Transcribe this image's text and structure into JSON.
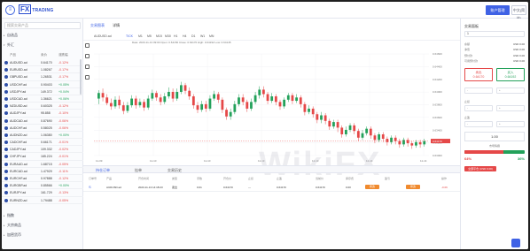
{
  "header": {
    "logo_fx": "FX",
    "logo_trading": "TRADING",
    "btn_primary": "账户管理",
    "btn_secondary": "中文(简体)"
  },
  "left": {
    "search_placeholder": "搜索交易产品",
    "sections": [
      "自选品",
      "外汇",
      "指数",
      "大宗商品",
      "加密货币"
    ],
    "columns": [
      "产品",
      "卖价",
      "涨跌幅"
    ],
    "rows": [
      {
        "symbol": "AUDUSD.ad",
        "price": "0.64170",
        "change": "-0.12%",
        "dir": "neg"
      },
      {
        "symbol": "EURUSD.ad",
        "price": "1.08267",
        "change": "-0.17%",
        "dir": "neg"
      },
      {
        "symbol": "GBPUSD.ad",
        "price": "1.26531",
        "change": "-0.17%",
        "dir": "neg"
      },
      {
        "symbol": "USDCHF.ad",
        "price": "0.90403",
        "change": "+0.05%",
        "dir": "pos"
      },
      {
        "symbol": "USDJPY.ad",
        "price": "149.372",
        "change": "+0.04%",
        "dir": "pos"
      },
      {
        "symbol": "USDCAD.ad",
        "price": "1.36621",
        "change": "+0.06%",
        "dir": "pos"
      },
      {
        "symbol": "NZDUSD.ad",
        "price": "0.60325",
        "change": "-0.12%",
        "dir": "neg"
      },
      {
        "symbol": "AUDJPY.ad",
        "price": "95.858",
        "change": "-0.10%",
        "dir": "neg"
      },
      {
        "symbol": "AUDCAD.ad",
        "price": "0.87690",
        "change": "-0.06%",
        "dir": "neg"
      },
      {
        "symbol": "AUDCHF.ad",
        "price": "0.58025",
        "change": "-0.06%",
        "dir": "neg"
      },
      {
        "symbol": "AUDNZD.ad",
        "price": "1.06380",
        "change": "+0.00%",
        "dir": "pos"
      },
      {
        "symbol": "CADCHF.ad",
        "price": "0.66171",
        "change": "-0.01%",
        "dir": "neg"
      },
      {
        "symbol": "CADJPY.ad",
        "price": "109.332",
        "change": "-0.02%",
        "dir": "neg"
      },
      {
        "symbol": "CHFJPY.ad",
        "price": "165.224",
        "change": "-0.01%",
        "dir": "neg"
      },
      {
        "symbol": "EURAUD.ad",
        "price": "1.68715",
        "change": "-0.05%",
        "dir": "neg"
      },
      {
        "symbol": "EURCAD.ad",
        "price": "1.47929",
        "change": "-0.11%",
        "dir": "neg"
      },
      {
        "symbol": "EURCHF.ad",
        "price": "0.97888",
        "change": "-0.12%",
        "dir": "neg"
      },
      {
        "symbol": "EURGBP.ad",
        "price": "0.85566",
        "change": "+0.00%",
        "dir": "pos"
      },
      {
        "symbol": "EURJPY.ad",
        "price": "161.729",
        "change": "-0.13%",
        "dir": "neg"
      },
      {
        "symbol": "EURNZD.ad",
        "price": "1.79488",
        "change": "-0.05%",
        "dir": "neg"
      }
    ]
  },
  "main": {
    "tabs": [
      "交易图表",
      "详情"
    ],
    "symbol": "AUDUSD.ad",
    "timeframes": [
      "TICK",
      "M1",
      "M5",
      "M15",
      "M30",
      "H1",
      "H4",
      "D1",
      "W1",
      "MN"
    ],
    "ohlc_line": "Date: 2023-11-13 09:00   Open: 0.64150   Close: 0.64170   High: 0.64192   Low: 0.64145",
    "ohlc_line2": "MA 5 10 20",
    "y_ticks": [
      "0.64600",
      "0.64400",
      "0.64200",
      "0.64000",
      "0.63800",
      "0.63600",
      "0.63400",
      "0.63200",
      "0.63000"
    ],
    "x_ticks": [
      "11-09",
      "11-10",
      "11-10",
      "11-13",
      "11-13",
      "11-14",
      "11-14"
    ],
    "price_tag": "0.64170",
    "bottom_tabs": [
      "持仓订单",
      "挂单",
      "交易历史"
    ],
    "pos_cols": [
      "订单号",
      "产品",
      "开仓时间",
      "类型",
      "手数",
      "开仓价",
      "止损",
      "止盈",
      "当前价",
      "库存费",
      "盈亏",
      "操作"
    ],
    "pos_row": {
      "id": "S",
      "symbol": "AUDUSD.ad",
      "time": "2023-11-13 14:18:23",
      "type": "卖出",
      "lots": "0.01",
      "open": "0.64170",
      "sl": "—",
      "tp": "—",
      "current": "0.64170",
      "swap": "0.00",
      "pnl": "-0.06",
      "btn_sl": "修改",
      "btn_tp": "修改",
      "btn_close": "平仓"
    }
  },
  "right": {
    "title": "交易面板",
    "account_select": "1",
    "kv": [
      {
        "k": "余额",
        "v": "USD 0.00"
      },
      {
        "k": "净值",
        "v": "USD 0.00"
      },
      {
        "k": "预付款",
        "v": "USD 0.00"
      },
      {
        "k": "可用预付款",
        "v": "USD 0.00"
      }
    ],
    "sell_label": "卖出",
    "sell_price": "0.64170",
    "buy_label": "买入",
    "buy_price": "0.64192",
    "sl_label": "止损",
    "tp_label": "止盈",
    "lot_value": "1.00",
    "sentiment_label": "市场情绪",
    "sell_pct": "64%",
    "buy_pct": "36%",
    "sell_pct_value": 0.64,
    "close_all": "全部平仓 (USD 0.00)"
  },
  "chart_data": {
    "type": "candlestick",
    "y_range": [
      0.6288,
      0.647
    ],
    "candles": [
      [
        0.639,
        0.64,
        0.638,
        0.6405
      ],
      [
        0.64,
        0.6392,
        0.6385,
        0.6408
      ],
      [
        0.6392,
        0.6382,
        0.6378,
        0.6398
      ],
      [
        0.6382,
        0.6376,
        0.637,
        0.639
      ],
      [
        0.6376,
        0.6388,
        0.6372,
        0.6394
      ],
      [
        0.6388,
        0.6378,
        0.6372,
        0.6395
      ],
      [
        0.6378,
        0.6368,
        0.6362,
        0.6384
      ],
      [
        0.6368,
        0.6378,
        0.6364,
        0.6384
      ],
      [
        0.6378,
        0.639,
        0.6374,
        0.6396
      ],
      [
        0.639,
        0.6378,
        0.6372,
        0.6395
      ],
      [
        0.6378,
        0.6384,
        0.6374,
        0.639
      ],
      [
        0.6384,
        0.6374,
        0.6368,
        0.6389
      ],
      [
        0.6374,
        0.639,
        0.637,
        0.6396
      ],
      [
        0.639,
        0.64,
        0.6386,
        0.6406
      ],
      [
        0.64,
        0.6392,
        0.6386,
        0.6404
      ],
      [
        0.6392,
        0.6384,
        0.6378,
        0.6398
      ],
      [
        0.6384,
        0.6394,
        0.638,
        0.64
      ],
      [
        0.6394,
        0.6402,
        0.639,
        0.641
      ],
      [
        0.6402,
        0.639,
        0.6384,
        0.6408
      ],
      [
        0.639,
        0.6402,
        0.6386,
        0.6408
      ],
      [
        0.6402,
        0.6414,
        0.6398,
        0.642
      ],
      [
        0.6414,
        0.6404,
        0.6398,
        0.6418
      ],
      [
        0.6404,
        0.6394,
        0.6388,
        0.641
      ],
      [
        0.6394,
        0.6378,
        0.6372,
        0.6398
      ],
      [
        0.6378,
        0.637,
        0.6364,
        0.6384
      ],
      [
        0.637,
        0.638,
        0.6366,
        0.6386
      ],
      [
        0.638,
        0.6372,
        0.6366,
        0.6386
      ],
      [
        0.6372,
        0.639,
        0.6368,
        0.6396
      ],
      [
        0.639,
        0.6398,
        0.6386,
        0.6404
      ],
      [
        0.6398,
        0.6388,
        0.6382,
        0.6402
      ],
      [
        0.6388,
        0.637,
        0.6364,
        0.6392
      ],
      [
        0.637,
        0.6358,
        0.6352,
        0.6374
      ],
      [
        0.6358,
        0.6366,
        0.6352,
        0.6372
      ],
      [
        0.6366,
        0.638,
        0.6362,
        0.6386
      ],
      [
        0.638,
        0.6392,
        0.6376,
        0.6398
      ],
      [
        0.6392,
        0.6384,
        0.6378,
        0.6398
      ],
      [
        0.6384,
        0.6372,
        0.6366,
        0.6388
      ],
      [
        0.6372,
        0.6384,
        0.6368,
        0.639
      ],
      [
        0.6384,
        0.6396,
        0.638,
        0.6402
      ],
      [
        0.6396,
        0.6406,
        0.639,
        0.6412
      ],
      [
        0.6406,
        0.6398,
        0.6392,
        0.6412
      ],
      [
        0.6398,
        0.6386,
        0.638,
        0.6402
      ],
      [
        0.6386,
        0.6394,
        0.6382,
        0.64
      ],
      [
        0.6394,
        0.6384,
        0.6378,
        0.6398
      ],
      [
        0.6384,
        0.6376,
        0.637,
        0.6388
      ],
      [
        0.6376,
        0.6388,
        0.6372,
        0.6392
      ],
      [
        0.6388,
        0.6396,
        0.6384,
        0.64
      ],
      [
        0.6396,
        0.6386,
        0.638,
        0.64
      ],
      [
        0.6386,
        0.6392,
        0.6382,
        0.6398
      ],
      [
        0.6392,
        0.638,
        0.6374,
        0.6396
      ],
      [
        0.638,
        0.6366,
        0.636,
        0.6384
      ],
      [
        0.6366,
        0.6372,
        0.6362,
        0.6378
      ],
      [
        0.6372,
        0.6362,
        0.6356,
        0.6376
      ],
      [
        0.6362,
        0.6352,
        0.6346,
        0.6366
      ],
      [
        0.6352,
        0.636,
        0.6346,
        0.6366
      ],
      [
        0.636,
        0.635,
        0.6344,
        0.6364
      ],
      [
        0.635,
        0.634,
        0.6334,
        0.6354
      ],
      [
        0.634,
        0.6348,
        0.6336,
        0.6352
      ],
      [
        0.6348,
        0.6338,
        0.633,
        0.6352
      ],
      [
        0.6338,
        0.6326,
        0.632,
        0.6342
      ],
      [
        0.6326,
        0.6334,
        0.6322,
        0.634
      ],
      [
        0.6334,
        0.6342,
        0.633,
        0.6346
      ],
      [
        0.6342,
        0.6332,
        0.6326,
        0.6346
      ],
      [
        0.6332,
        0.632,
        0.6314,
        0.6336
      ],
      [
        0.632,
        0.6328,
        0.6316,
        0.6334
      ],
      [
        0.6328,
        0.6336,
        0.6324,
        0.634
      ],
      [
        0.6336,
        0.6324,
        0.6318,
        0.634
      ],
      [
        0.6324,
        0.6316,
        0.631,
        0.6328
      ],
      [
        0.6316,
        0.6326,
        0.6312,
        0.633
      ],
      [
        0.6326,
        0.6318,
        0.6312,
        0.633
      ],
      [
        0.6318,
        0.6312,
        0.6306,
        0.6322
      ],
      [
        0.6312,
        0.632,
        0.6308,
        0.6324
      ],
      [
        0.632,
        0.6314,
        0.6308,
        0.6324
      ],
      [
        0.6314,
        0.6308,
        0.6302,
        0.6318
      ],
      [
        0.6308,
        0.6316,
        0.6304,
        0.632
      ],
      [
        0.6316,
        0.631,
        0.6304,
        0.632
      ],
      [
        0.631,
        0.6306,
        0.63,
        0.6314
      ],
      [
        0.6306,
        0.6312,
        0.6302,
        0.6316
      ],
      [
        0.6312,
        0.6308,
        0.6302,
        0.6316
      ],
      [
        0.6308,
        0.6314,
        0.6304,
        0.6318
      ]
    ]
  }
}
